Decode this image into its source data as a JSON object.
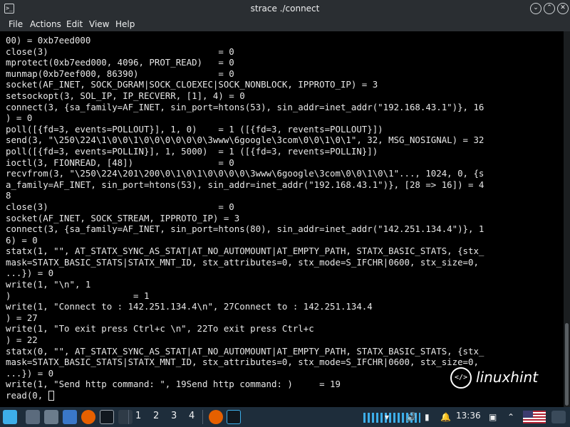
{
  "window": {
    "title": "strace ./connect",
    "app_icon": "terminal-icon",
    "buttons": [
      "chevron-down-icon",
      "chevron-up-icon",
      "close-icon"
    ]
  },
  "menubar": {
    "items": [
      "File",
      "Actions",
      "Edit",
      "View",
      "Help"
    ]
  },
  "terminal": {
    "lines": [
      "00) = 0xb7eed000",
      "close(3)                                = 0",
      "mprotect(0xb7eed000, 4096, PROT_READ)   = 0",
      "munmap(0xb7eef000, 86390)               = 0",
      "socket(AF_INET, SOCK_DGRAM|SOCK_CLOEXEC|SOCK_NONBLOCK, IPPROTO_IP) = 3",
      "setsockopt(3, SOL_IP, IP_RECVERR, [1], 4) = 0",
      "connect(3, {sa_family=AF_INET, sin_port=htons(53), sin_addr=inet_addr(\"192.168.43.1\")}, 16",
      ") = 0",
      "poll([{fd=3, events=POLLOUT}], 1, 0)    = 1 ([{fd=3, revents=POLLOUT}])",
      "send(3, \"\\250\\224\\1\\0\\0\\1\\0\\0\\0\\0\\0\\0\\3www\\6google\\3com\\0\\0\\1\\0\\1\", 32, MSG_NOSIGNAL) = 32",
      "poll([{fd=3, events=POLLIN}], 1, 5000)  = 1 ([{fd=3, revents=POLLIN}])",
      "ioctl(3, FIONREAD, [48])                = 0",
      "recvfrom(3, \"\\250\\224\\201\\200\\0\\1\\0\\1\\0\\0\\0\\0\\3www\\6google\\3com\\0\\0\\1\\0\\1\"..., 1024, 0, {s",
      "a_family=AF_INET, sin_port=htons(53), sin_addr=inet_addr(\"192.168.43.1\")}, [28 => 16]) = 4",
      "8",
      "close(3)                                = 0",
      "socket(AF_INET, SOCK_STREAM, IPPROTO_IP) = 3",
      "connect(3, {sa_family=AF_INET, sin_port=htons(80), sin_addr=inet_addr(\"142.251.134.4\")}, 1",
      "6) = 0",
      "statx(1, \"\", AT_STATX_SYNC_AS_STAT|AT_NO_AUTOMOUNT|AT_EMPTY_PATH, STATX_BASIC_STATS, {stx_",
      "mask=STATX_BASIC_STATS|STATX_MNT_ID, stx_attributes=0, stx_mode=S_IFCHR|0600, stx_size=0,",
      "...}) = 0",
      "write(1, \"\\n\", 1",
      ")                       = 1",
      "write(1, \"Connect to : 142.251.134.4\\n\", 27Connect to : 142.251.134.4",
      ") = 27",
      "write(1, \"To exit press Ctrl+c \\n\", 22To exit press Ctrl+c",
      ") = 22",
      "statx(0, \"\", AT_STATX_SYNC_AS_STAT|AT_NO_AUTOMOUNT|AT_EMPTY_PATH, STATX_BASIC_STATS, {stx_",
      "mask=STATX_BASIC_STATS|STATX_MNT_ID, stx_attributes=0, stx_mode=S_IFCHR|0600, stx_size=0,",
      "...}) = 0",
      "write(1, \"Send http command: \", 19Send http command: )     = 19",
      "read(0, "
    ]
  },
  "watermark": {
    "text": "linuxhint",
    "logo_glyph": "</>"
  },
  "taskbar": {
    "workspaces": [
      "1",
      "2",
      "3",
      "4"
    ],
    "clock": "13:36",
    "colors": {
      "background": "#1e2d3b",
      "accent": "#3daee9"
    }
  }
}
